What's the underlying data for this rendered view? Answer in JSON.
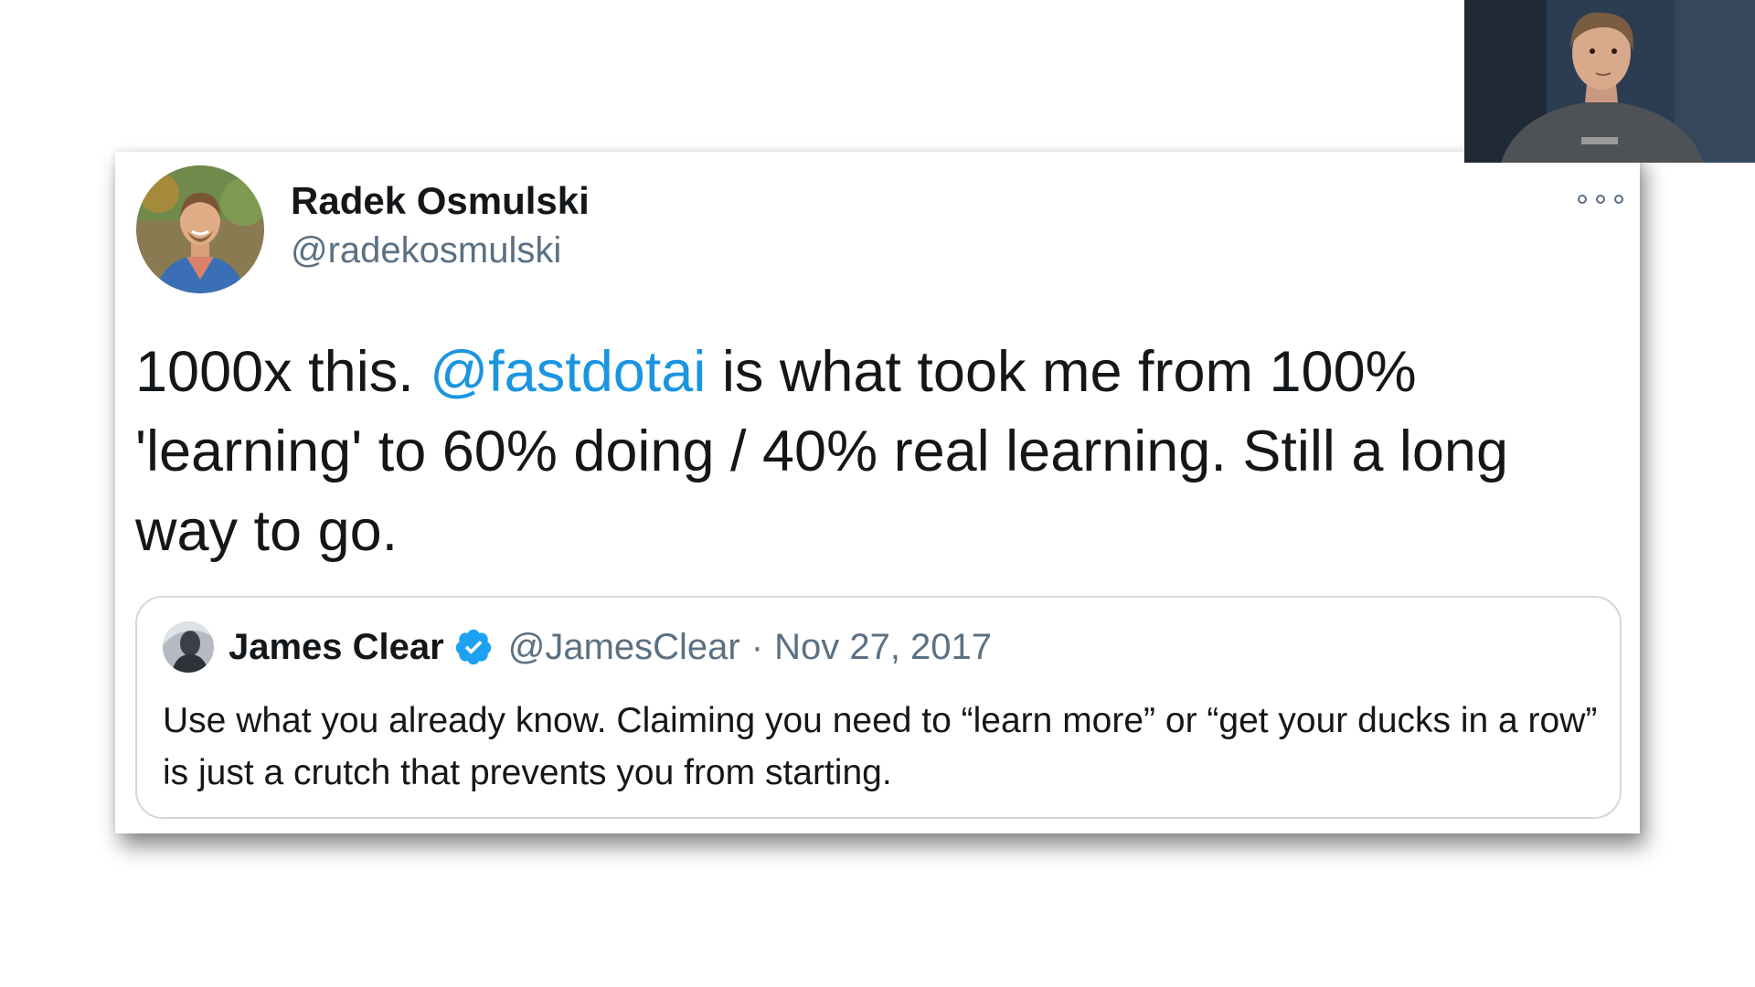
{
  "tweet": {
    "author_name": "Radek Osmulski",
    "author_handle": "@radekosmulski",
    "avatar_icon": "profile-photo",
    "text_before": "1000x this. ",
    "mention": "@fastdotai",
    "text_after": " is what took me from 100% 'learning' to 60% doing / 40% real learning. Still a long way to go.",
    "menu_icon": "more-options-icon"
  },
  "quoted_tweet": {
    "author_name": "James Clear",
    "verified_icon": "verified-badge-icon",
    "author_handle": "@JamesClear",
    "separator": "·",
    "date": "Nov 27, 2017",
    "text": "Use what you already know. Claiming you need to “learn more” or “get your ducks in a row” is just a crutch that prevents you from starting."
  },
  "overlay": {
    "webcam_icon": "presenter-webcam"
  },
  "colors": {
    "mention": "#1b95e0",
    "secondary_text": "#5b7083",
    "primary_text": "#14171a",
    "verified": "#1da1f2"
  }
}
